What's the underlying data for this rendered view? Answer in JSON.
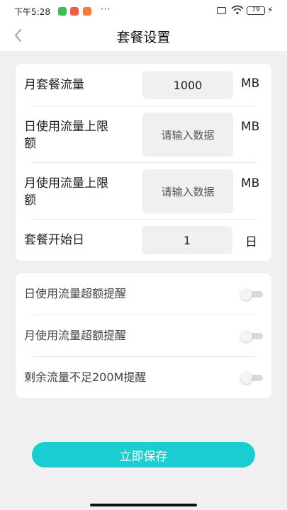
{
  "status_bar": {
    "time": "下午5:28",
    "more": "···",
    "battery": "79"
  },
  "nav": {
    "title": "套餐设置"
  },
  "plan": {
    "monthly_data": {
      "label": "月套餐流量",
      "value": "1000",
      "unit": "MB"
    },
    "daily_limit": {
      "label_line1": "日使用流量上限",
      "label_line2": "额",
      "placeholder": "请输入数据",
      "unit": "MB"
    },
    "monthly_limit": {
      "label_line1": "月使用流量上限",
      "label_line2": "额",
      "placeholder": "请输入数据",
      "unit": "MB"
    },
    "start_day": {
      "label": "套餐开始日",
      "value": "1",
      "unit": "日"
    }
  },
  "reminders": [
    {
      "label": "日使用流量超额提醒",
      "enabled": false
    },
    {
      "label": "月使用流量超额提醒",
      "enabled": false
    },
    {
      "label": "剩余流量不足200M提醒",
      "enabled": false
    }
  ],
  "save_label": "立即保存",
  "colors": {
    "accent": "#19cdd2",
    "background": "#f0f0f2",
    "card": "#ffffff"
  }
}
